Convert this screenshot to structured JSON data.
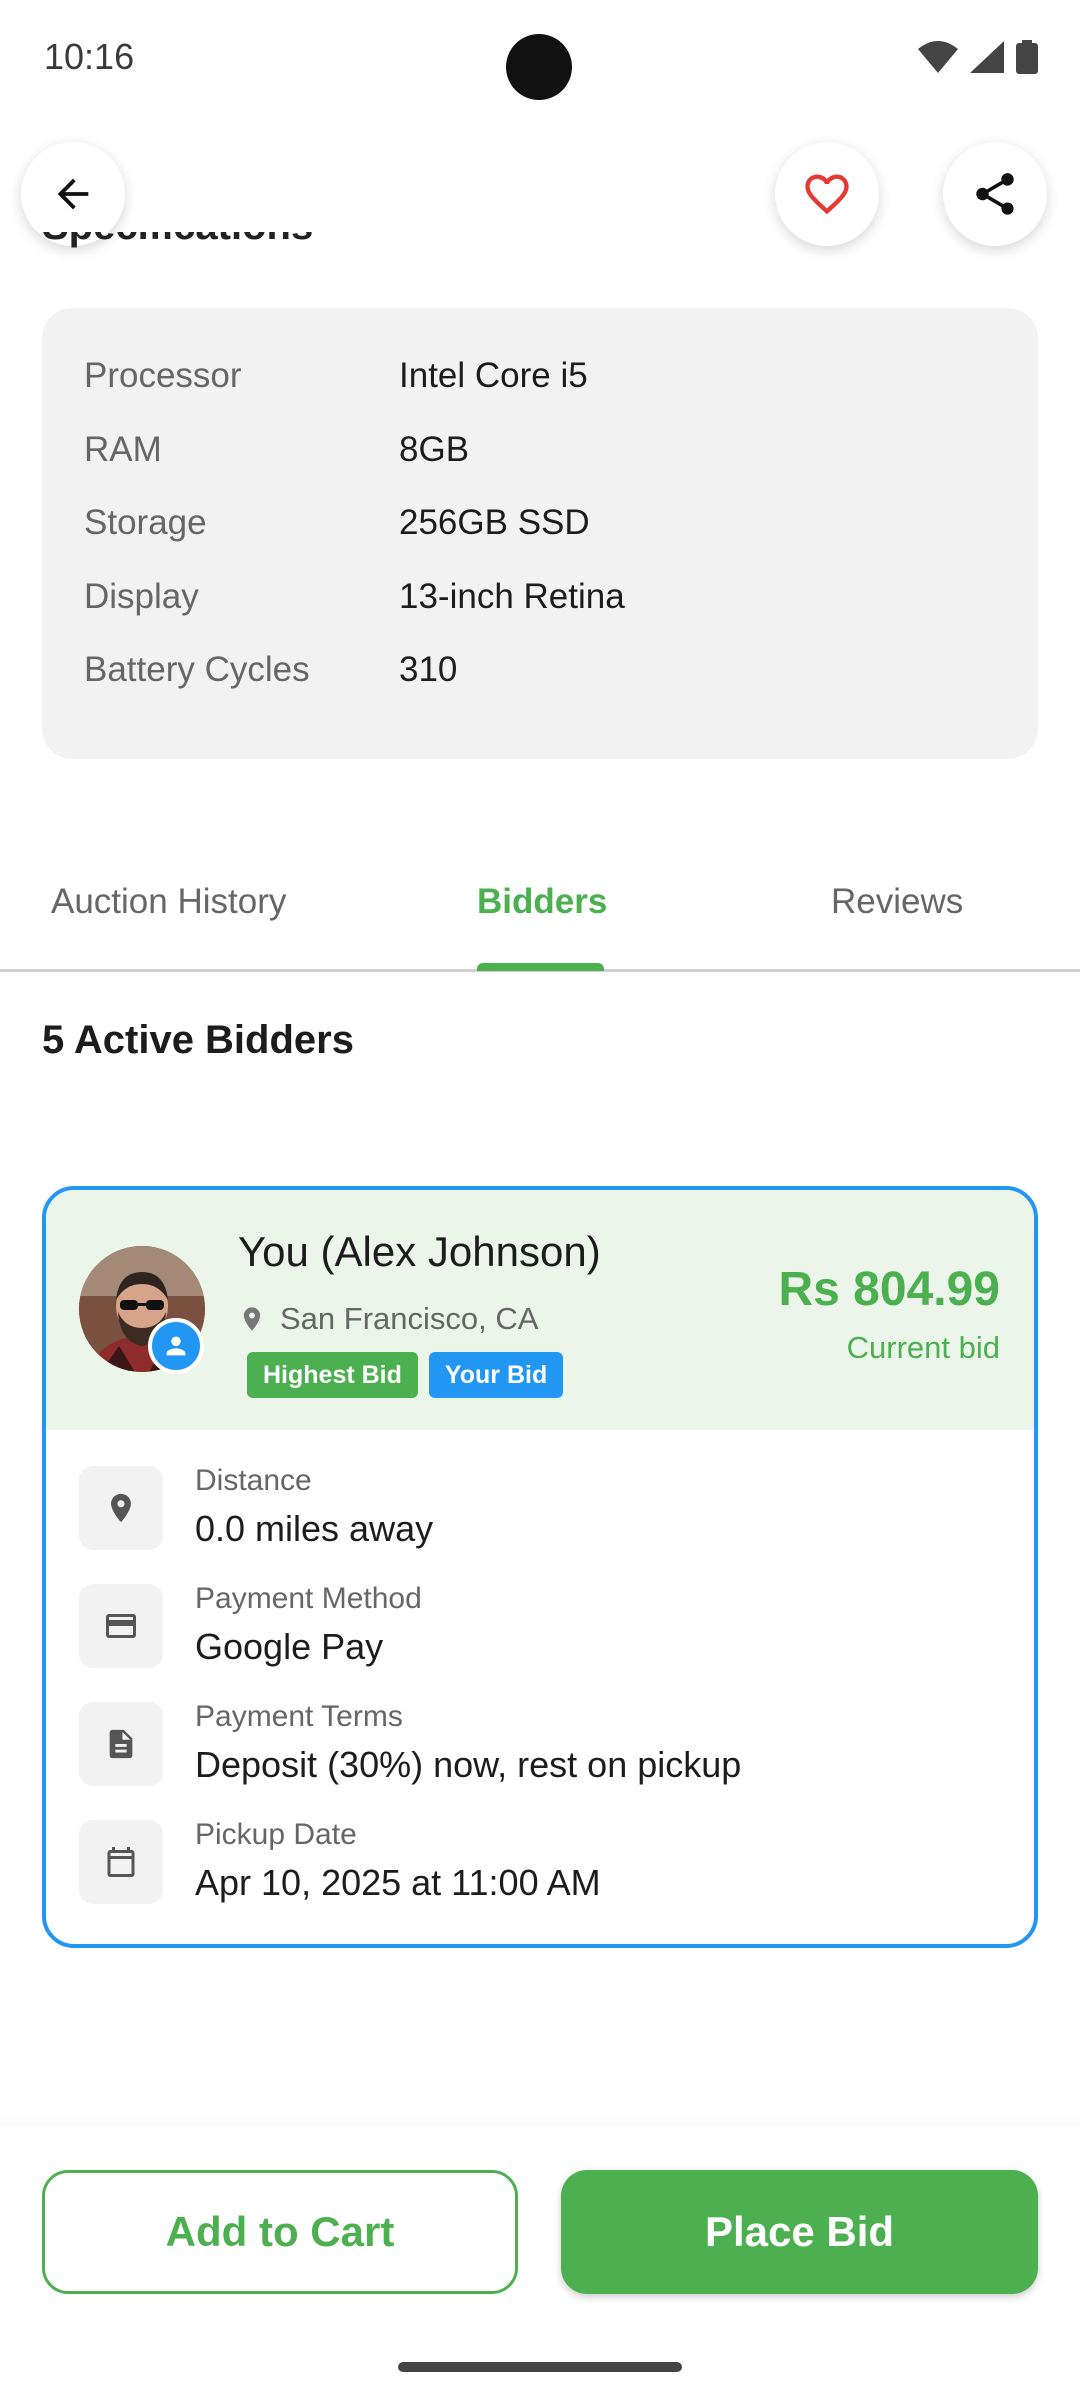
{
  "status_bar": {
    "time": "10:16"
  },
  "header": {
    "back_icon": "arrow-left-icon",
    "favorite_icon": "heart-outline-icon",
    "share_icon": "share-icon",
    "partial_heading": "Specifications"
  },
  "specs": [
    {
      "label": "Processor",
      "value": "Intel Core i5"
    },
    {
      "label": "RAM",
      "value": "8GB"
    },
    {
      "label": "Storage",
      "value": "256GB SSD"
    },
    {
      "label": "Display",
      "value": "13-inch Retina"
    },
    {
      "label": "Battery Cycles",
      "value": "310"
    }
  ],
  "tabs": [
    {
      "label": "Auction History",
      "active": false
    },
    {
      "label": "Bidders",
      "active": true
    },
    {
      "label": "Reviews",
      "active": false
    }
  ],
  "bidders": {
    "heading": "5 Active Bidders",
    "card": {
      "name": "You (Alex Johnson)",
      "location": "San Francisco, CA",
      "badges": [
        "Highest Bid",
        "Your Bid"
      ],
      "amount": "Rs 804.99",
      "amount_caption": "Current bid",
      "details": [
        {
          "icon": "location-pin-icon",
          "label": "Distance",
          "value": "0.0 miles away"
        },
        {
          "icon": "credit-card-icon",
          "label": "Payment Method",
          "value": "Google Pay"
        },
        {
          "icon": "document-icon",
          "label": "Payment Terms",
          "value": "Deposit (30%) now, rest on pickup"
        },
        {
          "icon": "calendar-icon",
          "label": "Pickup Date",
          "value": "Apr 10, 2025 at 11:00 AM"
        }
      ]
    }
  },
  "actions": {
    "add_to_cart": "Add to Cart",
    "place_bid": "Place Bid"
  },
  "colors": {
    "accent_green": "#4caf50",
    "accent_blue": "#2196f3",
    "favorite_red": "#e53935"
  }
}
